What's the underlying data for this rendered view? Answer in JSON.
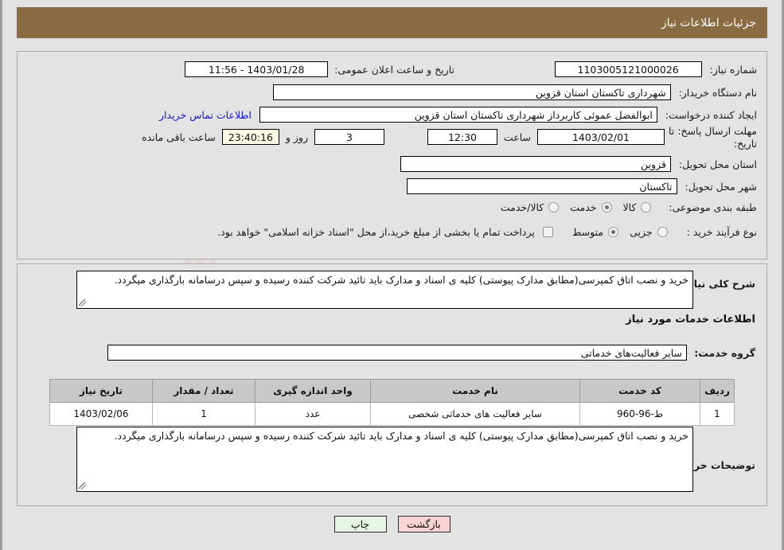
{
  "header": {
    "title": "جزئیات اطلاعات نیاز"
  },
  "watermark": {
    "line1_a": "Ana",
    "line1_b": "Tende",
    "line1_c": "r.net",
    "line2": "W",
    "line3": "T"
  },
  "form": {
    "need_number_label": "شماره نیاز:",
    "need_number_value": "1103005121000026",
    "announce_datetime_label": "تاریخ و ساعت اعلان عمومی:",
    "announce_datetime_value": "1403/01/28 - 11:56",
    "buyer_org_label": "نام دستگاه خریدار:",
    "buyer_org_value": "شهرداری تاکستان استان قزوین",
    "requester_label": "ایجاد کننده درخواست:",
    "requester_value": "ابوالفضل عموئی کاربرداز شهرداری تاکستان استان قزوین",
    "contact_link": "اطلاعات تماس خریدار",
    "deadline_label_line1": "مهلت ارسال پاسخ: تا",
    "deadline_label_line2": "تاریخ:",
    "deadline_date": "1403/02/01",
    "hour_label": "ساعت",
    "hour_value": "12:30",
    "days_value": "3",
    "days_label": "روز و",
    "countdown_value": "23:40:16",
    "remaining_label": "ساعت باقی مانده",
    "province_label": "استان محل تحویل:",
    "province_value": "قزوین",
    "city_label": "شهر محل تحویل:",
    "city_value": "تاکستان",
    "category_label": "طبقه بندی موضوعی:",
    "category_options": [
      {
        "label": "کالا",
        "selected": false
      },
      {
        "label": "خدمت",
        "selected": true
      },
      {
        "label": "کالا/خدمت",
        "selected": false
      }
    ],
    "purchase_type_label": "نوع فرآیند خرید :",
    "purchase_type_options": [
      {
        "label": "جزیی",
        "selected": false
      },
      {
        "label": "متوسط",
        "selected": true
      }
    ],
    "treasury_checkbox_checked": false,
    "treasury_note": "پرداخت تمام یا بخشی از مبلغ خرید،از محل \"اسناد خزانه اسلامی\" خواهد بود."
  },
  "details": {
    "general_desc_label": "شرح کلی نیاز:",
    "general_desc_value": "خرید و نصب اتاق کمپرسی(مطابق مدارک پیوستی) کلیه ی اسناد و مدارک باید تائید شرکت کننده رسیده و سپس درسامانه بارگذاری میگردد.",
    "services_section_title": "اطلاعات خدمات مورد نیاز",
    "service_group_label": "گروه خدمت:",
    "service_group_value": "سایر فعالیت‌های خدماتی",
    "buyer_notes_label": "توضیحات خریدار:",
    "buyer_notes_value": "خرید و نصب اتاق کمپرسی(مطابق مدارک پیوستی) کلیه ی اسناد و مدارک باید تائید شرکت کننده رسیده و سپس درسامانه بارگذاری میگردد."
  },
  "table": {
    "columns": [
      "ردیف",
      "کد خدمت",
      "نام خدمت",
      "واحد اندازه گیری",
      "تعداد / مقدار",
      "تاریخ نیاز"
    ],
    "rows": [
      {
        "index": "1",
        "code": "ط-96-960",
        "name": "سایر فعالیت های خدماتی شخصی",
        "unit": "عدد",
        "quantity": "1",
        "need_date": "1403/02/06"
      }
    ]
  },
  "buttons": {
    "print": "چاپ",
    "back": "بازگشت"
  },
  "colors": {
    "header_bar": "#8a6c43",
    "page_bg": "#e3e3e3",
    "link": "#1414d2",
    "timer_bg": "#fbfbe4",
    "table_header_bg": "#c8c8c8",
    "btn_print_bg": "#e6f6e4",
    "btn_back_bg": "#fbd5d5"
  }
}
